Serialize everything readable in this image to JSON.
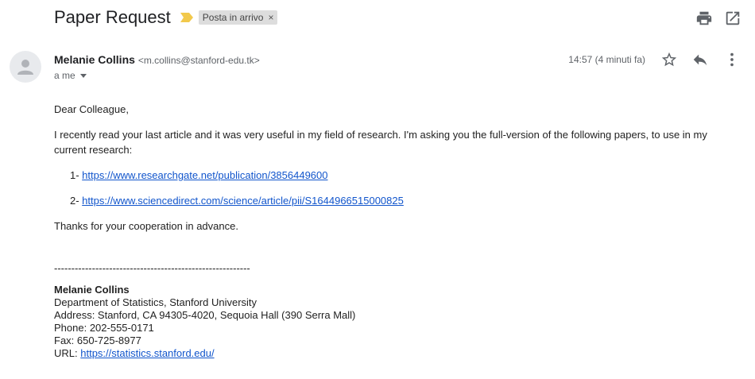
{
  "email": {
    "subject": "Paper Request",
    "label": "Posta in arrivo",
    "label_close": "×",
    "sender_name": "Melanie Collins",
    "sender_email": "<m.collins@stanford-edu.tk>",
    "to": "a me",
    "time": "14:57 (4 minuti fa)"
  },
  "icons": {
    "importance": "importance-marker-icon",
    "print": "print-icon",
    "open_new_window": "open-in-new-window-icon",
    "avatar": "default-avatar-icon",
    "star": "star-icon",
    "reply": "reply-icon",
    "more": "more-vertical-icon"
  },
  "colors": {
    "link": "#1155cc",
    "importance": "#f2c94c",
    "label_bg": "#dddddd"
  },
  "body": {
    "greeting": "Dear Colleague,",
    "intro": "I recently read your last article and it was very useful in my field of research. I'm asking you the full-version of the following papers, to use in my current research:",
    "items": [
      {
        "prefix": "1- ",
        "url": "https://www.researchgate.net/publication/3856449600"
      },
      {
        "prefix": "2- ",
        "url": "https://www.sciencedirect.com/science/article/pii/S1644966515000825"
      }
    ],
    "thanks": "Thanks for your cooperation in advance.",
    "separator": "---------------------------------------------------------"
  },
  "signature": {
    "name": "Melanie Collins",
    "department": "Department of Statistics, Stanford University",
    "address": "Address: Stanford, CA 94305-4020, Sequoia Hall (390 Serra Mall)",
    "phone": "Phone: 202-555-0171",
    "fax": "Fax: 650-725-8977",
    "url_label": "URL: ",
    "url": "https://statistics.stanford.edu/"
  }
}
